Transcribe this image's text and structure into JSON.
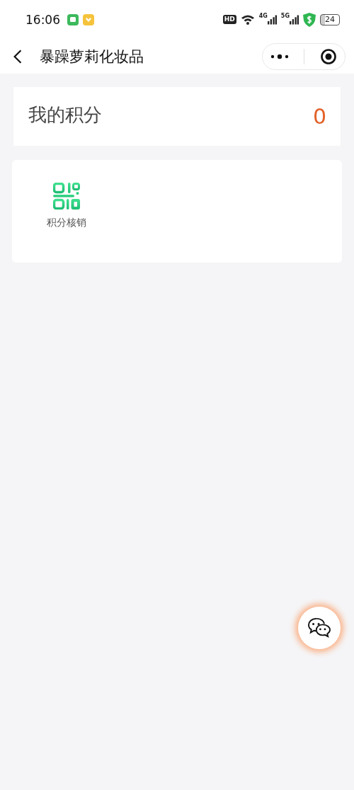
{
  "status_bar": {
    "time": "16:06",
    "hd": "HD",
    "network_1": "4G",
    "network_2": "5G",
    "battery": "24"
  },
  "nav": {
    "title": "暴躁萝莉化妆品"
  },
  "points": {
    "label": "我的积分",
    "value": "0"
  },
  "actions": [
    {
      "label": "积分核销"
    }
  ]
}
